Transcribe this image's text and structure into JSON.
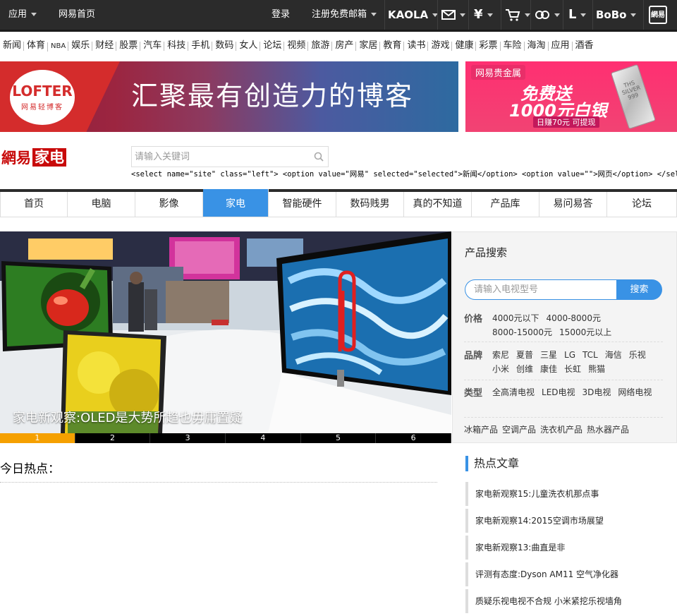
{
  "topbar": {
    "apps_label": "应用",
    "home_label": "网易首页",
    "login_label": "登录",
    "register_label": "注册免费邮箱",
    "kaola_label": "KAOLA",
    "l_label": "L",
    "bobo_label": "BoBo",
    "netease_mini_label": "網易"
  },
  "channels": [
    "新闻",
    "体育",
    "NBA",
    "娱乐",
    "财经",
    "股票",
    "汽车",
    "科技",
    "手机",
    "数码",
    "女人",
    "论坛",
    "视频",
    "旅游",
    "房产",
    "家居",
    "教育",
    "读书",
    "游戏",
    "健康",
    "彩票",
    "车险",
    "海淘",
    "应用",
    "酒香"
  ],
  "banner_left": {
    "logo_name": "LOFTER",
    "logo_sub": "网易轻博客",
    "slogan": "汇聚最有创造力的博客"
  },
  "banner_right": {
    "logo": "网易贵金属",
    "title1": "免费送",
    "title2": "1000元白银",
    "sub": "日赚70元 可提现",
    "bar_text": "THS SILVER 999"
  },
  "logo": {
    "part1": "網易",
    "part2": "家电"
  },
  "search": {
    "placeholder": "请输入关键词"
  },
  "raw_select_text": "<select name=\"site\" class=\"left\"> <option value=\"网易\" selected=\"selected\">新闻</option> <option value=\"\">网页</option> </select>",
  "mainnav": [
    "首页",
    "电脑",
    "影像",
    "家电",
    "智能硬件",
    "数码贱男",
    "真的不知道",
    "产品库",
    "易问易答",
    "论坛"
  ],
  "mainnav_active": 3,
  "slider": {
    "caption": "家电新观察:OLED是大势所趋也毋庸置疑",
    "dots": [
      "1",
      "2",
      "3",
      "4",
      "5",
      "6"
    ],
    "active_dot": 0
  },
  "product_search": {
    "title": "产品搜索",
    "placeholder": "请输入电视型号",
    "button": "搜索",
    "rows": [
      {
        "label": "价格",
        "links": [
          "4000元以下",
          "4000-8000元",
          "8000-15000元",
          "15000元以上"
        ]
      },
      {
        "label": "品牌",
        "links": [
          "索尼",
          "夏普",
          "三星",
          "LG",
          "TCL",
          "海信",
          "乐视",
          "小米",
          "创维",
          "康佳",
          "长虹",
          "熊猫"
        ]
      },
      {
        "label": "类型",
        "links": [
          "全高清电视",
          "LED电视",
          "3D电视",
          "网络电视"
        ]
      },
      {
        "label": "",
        "links": [
          "冰箱产品",
          "空调产品",
          "洗衣机产品",
          "热水器产品"
        ]
      }
    ]
  },
  "today": {
    "title": "今日热点："
  },
  "hot": {
    "title": "热点文章",
    "items": [
      "家电新观察15:儿童洗衣机那点事",
      "家电新观察14:2015空调市场展望",
      "家电新观察13:曲直是非",
      "评测有态度:Dyson AM11 空气净化器",
      "质疑乐视电视不合规 小米紧挖乐视墙角"
    ]
  },
  "colors": {
    "accent": "#3992e5",
    "topbar": "#2b2b2b",
    "dot_active": "#f5a000",
    "logo_red": "#c80a0a"
  }
}
